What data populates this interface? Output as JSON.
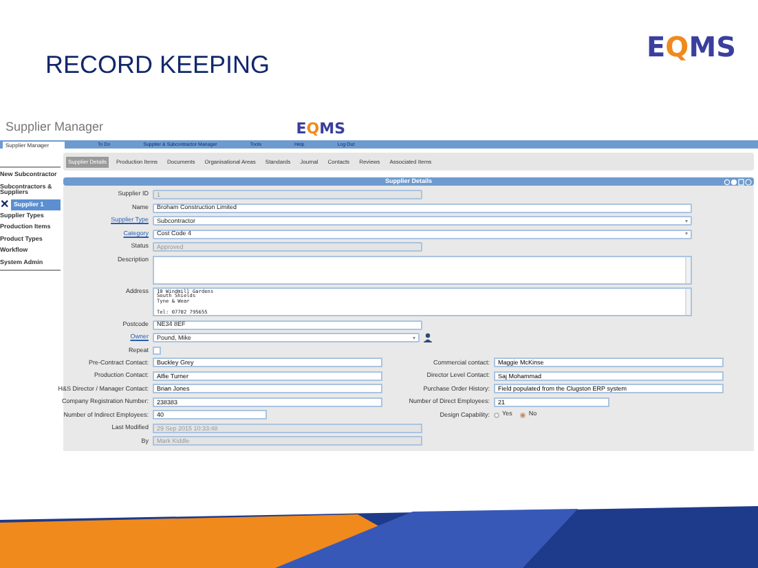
{
  "slide": {
    "title": "RECORD KEEPING",
    "logo": {
      "left": "E",
      "mid": "Q",
      "right": "MS"
    }
  },
  "app": {
    "title": "Supplier Manager",
    "logo": {
      "left": "E",
      "mid": "Q",
      "right": "MS"
    },
    "menu_select": "Supplier Manager",
    "menu": [
      "To Do",
      "Supplier & Subcontractor Manager",
      "Tools",
      "Help",
      "Log Out"
    ],
    "tabs": [
      {
        "label": "Supplier Details",
        "selected": true
      },
      {
        "label": "Production Items",
        "selected": false
      },
      {
        "label": "Documents",
        "selected": false
      },
      {
        "label": "Organisational Areas",
        "selected": false
      },
      {
        "label": "Standards",
        "selected": false
      },
      {
        "label": "Journal",
        "selected": false
      },
      {
        "label": "Contacts",
        "selected": false
      },
      {
        "label": "Reviews",
        "selected": false
      },
      {
        "label": "Associated Items",
        "selected": false
      }
    ],
    "sidebar": [
      {
        "label": "New Subcontractor",
        "selected": false
      },
      {
        "label": "Subcontractors & Suppliers",
        "selected": false,
        "children": [
          {
            "label": "Supplier 1",
            "selected": true,
            "close_icon": "✕"
          }
        ]
      },
      {
        "label": "Supplier Types",
        "selected": false
      },
      {
        "label": "Production Items",
        "selected": false
      },
      {
        "label": "Product Types",
        "selected": false
      },
      {
        "label": "Workflow",
        "selected": false
      },
      {
        "label": "System Admin",
        "selected": false
      }
    ],
    "panel_title": "Supplier Details",
    "fields": [
      {
        "label": "Supplier ID",
        "kind": "readonly",
        "value": "1",
        "link": false
      },
      {
        "label": "Name",
        "kind": "text",
        "value": "Broham Construction Limited",
        "link": false
      },
      {
        "label": "Supplier Type",
        "kind": "select",
        "value": "Subcontractor",
        "link": true
      },
      {
        "label": "Category",
        "kind": "select",
        "value": "Cost Code 4",
        "link": true
      },
      {
        "label": "Status",
        "kind": "readonly",
        "value": "Approved",
        "link": false
      },
      {
        "label": "Description",
        "kind": "textarea",
        "link": false
      },
      {
        "label": "Address",
        "kind": "textarea",
        "value": "10 Windmill Gardens\nSouth Shields\nTyne & Wear\n\nTel: 07702 795655",
        "link": false
      },
      {
        "label": "Postcode",
        "kind": "text",
        "value": "NE34 8EF",
        "link": false
      },
      {
        "label": "Owner",
        "kind": "person",
        "value": "Pound, Mike",
        "link": true
      },
      {
        "label": "Repeat",
        "kind": "checkbox",
        "checked": false,
        "link": false
      }
    ],
    "pairs": [
      {
        "left": {
          "label": "Pre-Contract Contact:",
          "value": "Buckley Grey"
        },
        "right": {
          "label": "Commercial contact:",
          "kind": "text",
          "value": "Maggie McKinse"
        }
      },
      {
        "left": {
          "label": "Production Contact:",
          "value": "Alfie Turner"
        },
        "right": {
          "label": "Director Level Contact:",
          "kind": "text",
          "value": "Saj Mohammad"
        }
      },
      {
        "left": {
          "label": "H&S Director / Manager Contact:",
          "value": "Brian Jones"
        },
        "right": {
          "label": "Purchase Order History:",
          "kind": "text",
          "value": "Field populated from the Clugston ERP system"
        }
      },
      {
        "left": {
          "label": "Company Registration Number:",
          "value": "238383"
        },
        "right": {
          "label": "Number of Direct Employees:",
          "kind": "short",
          "value": "21"
        }
      },
      {
        "left": {
          "label": "Number of Indirect Employees:",
          "value": "40"
        },
        "right": {
          "label": "Design Capability:",
          "kind": "radio",
          "options": [
            {
              "label": "Yes",
              "selected": false
            },
            {
              "label": "No",
              "selected": true
            }
          ]
        }
      }
    ],
    "footer_fields": [
      {
        "label": "Last Modified",
        "value": "29 Sep 2015 10:33:48"
      },
      {
        "label": "By",
        "value": "Mark Kiddle"
      }
    ]
  }
}
